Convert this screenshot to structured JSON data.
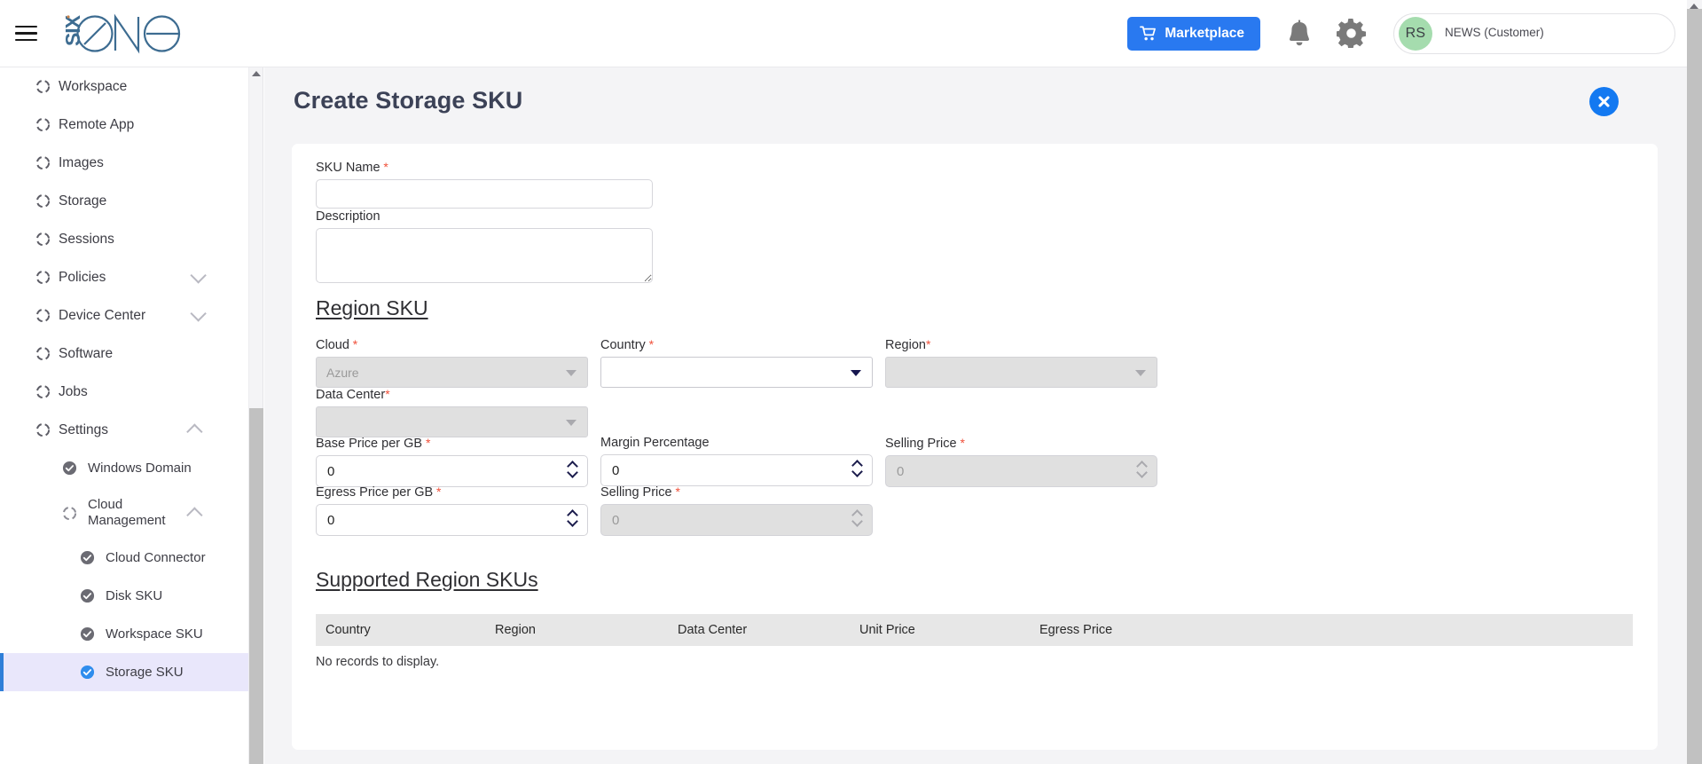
{
  "header": {
    "logo_text": "SIX ONE",
    "menu_icon": "hamburger-icon",
    "marketplace_label": "Marketplace",
    "cart_icon": "cart-icon",
    "bell_icon": "bell-icon",
    "gear_icon": "gear-icon",
    "user": {
      "initials": "RS",
      "name": "NEWS (Customer)",
      "subtitle": ""
    }
  },
  "sidebar": {
    "items": [
      {
        "label": "Workspace",
        "level": 1,
        "icon": "dashed-circle-icon",
        "chevron": "",
        "active": false
      },
      {
        "label": "Remote App",
        "level": 1,
        "icon": "dashed-circle-icon",
        "chevron": "",
        "active": false
      },
      {
        "label": "Images",
        "level": 1,
        "icon": "dashed-circle-icon",
        "chevron": "",
        "active": false
      },
      {
        "label": "Storage",
        "level": 1,
        "icon": "dashed-circle-icon",
        "chevron": "",
        "active": false
      },
      {
        "label": "Sessions",
        "level": 1,
        "icon": "dashed-circle-icon",
        "chevron": "",
        "active": false
      },
      {
        "label": "Policies",
        "level": 1,
        "icon": "dashed-circle-icon",
        "chevron": "down",
        "active": false
      },
      {
        "label": "Device Center",
        "level": 1,
        "icon": "dashed-circle-icon",
        "chevron": "down",
        "active": false
      },
      {
        "label": "Software",
        "level": 1,
        "icon": "dashed-circle-icon",
        "chevron": "",
        "active": false
      },
      {
        "label": "Jobs",
        "level": 1,
        "icon": "dashed-circle-icon",
        "chevron": "",
        "active": false
      },
      {
        "label": "Settings",
        "level": 1,
        "icon": "dashed-circle-icon",
        "chevron": "up",
        "active": false
      },
      {
        "label": "Windows Domain",
        "level": 2,
        "icon": "check-circle-icon",
        "chevron": "",
        "active": false
      },
      {
        "label": "Cloud Management",
        "level": 2,
        "icon": "dashed-circle-icon",
        "chevron": "up",
        "active": false
      },
      {
        "label": "Cloud Connector",
        "level": 3,
        "icon": "check-circle-icon",
        "chevron": "",
        "active": false
      },
      {
        "label": "Disk SKU",
        "level": 3,
        "icon": "check-circle-icon",
        "chevron": "",
        "active": false
      },
      {
        "label": "Workspace SKU",
        "level": 3,
        "icon": "check-circle-icon",
        "chevron": "",
        "active": false
      },
      {
        "label": "Storage SKU",
        "level": 3,
        "icon": "check-circle-icon",
        "chevron": "",
        "active": true
      }
    ]
  },
  "page": {
    "title": "Create Storage SKU",
    "close_icon": "close-circle-icon"
  },
  "form": {
    "sku_name": {
      "label": "SKU Name",
      "required": true,
      "value": "",
      "placeholder": ""
    },
    "description": {
      "label": "Description",
      "required": false,
      "value": "",
      "placeholder": ""
    },
    "region_sku_heading": "Region SKU",
    "cloud": {
      "label": "Cloud",
      "required": true,
      "value": "Azure",
      "disabled": true
    },
    "country": {
      "label": "Country",
      "required": true,
      "value": "",
      "disabled": false
    },
    "region": {
      "label": "Region",
      "required": true,
      "value": "",
      "disabled": true
    },
    "data_center": {
      "label": "Data Center",
      "required": true,
      "value": "",
      "disabled": true
    },
    "base_price_per_gb": {
      "label": "Base Price per GB",
      "required": true,
      "value": "0",
      "disabled": false
    },
    "margin_percentage": {
      "label": "Margin Percentage",
      "required": false,
      "value": "0",
      "disabled": false
    },
    "selling_price_1": {
      "label": "Selling Price",
      "required": true,
      "value": "0",
      "disabled": true
    },
    "egress_price_per_gb": {
      "label": "Egress Price per GB",
      "required": true,
      "value": "0",
      "disabled": false
    },
    "selling_price_2": {
      "label": "Selling Price",
      "required": true,
      "value": "0",
      "disabled": true
    }
  },
  "table": {
    "heading": "Supported Region SKUs",
    "columns": [
      "Country",
      "Region",
      "Data Center",
      "Unit Price",
      "Egress Price"
    ],
    "rows": [],
    "empty_message": "No records to display."
  },
  "colors": {
    "accent_blue": "#2979f0",
    "close_blue": "#1379f1",
    "active_nav_bg": "#e9e7fb",
    "active_nav_bar": "#2f7fd8",
    "avatar_green": "#a5dcae",
    "required_red": "#f0503a",
    "page_bg": "#f4f4f6",
    "table_header_bg": "#e7e7e7",
    "logo_blue": "#3d6c91"
  }
}
